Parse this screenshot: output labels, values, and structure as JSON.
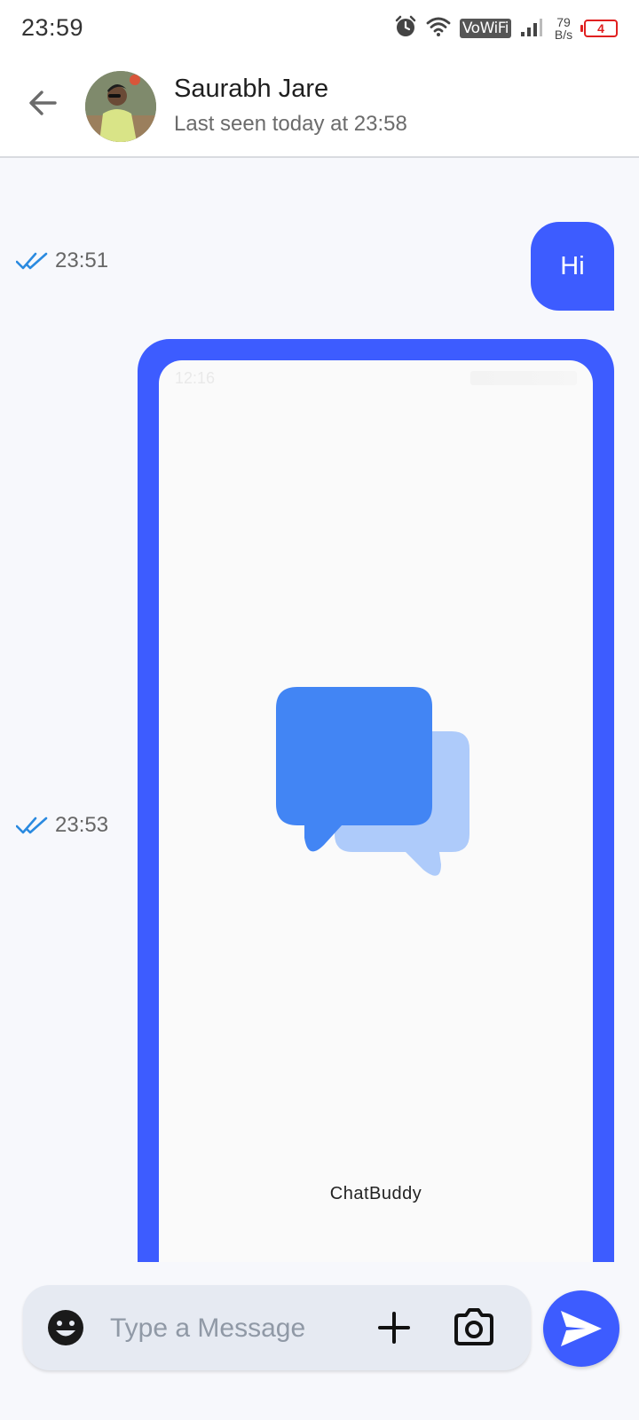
{
  "status_bar": {
    "time": "23:59",
    "vowifi": "VoWiFi",
    "net_speed_value": "79",
    "net_speed_unit": "B/s",
    "battery": "4",
    "icons": [
      "alarm-icon",
      "wifi-icon",
      "signal-icon",
      "battery-icon"
    ]
  },
  "header": {
    "contact_name": "Saurabh Jare",
    "last_seen": "Last seen today at 23:58"
  },
  "messages": [
    {
      "type": "text",
      "text": "Hi",
      "time": "23:51",
      "read": true
    },
    {
      "type": "image",
      "time": "23:53",
      "read": true,
      "image_status_time": "12:16",
      "image_caption": "ChatBuddy"
    }
  ],
  "composer": {
    "placeholder": "Type a Message"
  },
  "colors": {
    "accent": "#3d5cff",
    "read_tick": "#2a8ae0",
    "logo_front": "#4285f4",
    "logo_back": "#aecbfa"
  }
}
